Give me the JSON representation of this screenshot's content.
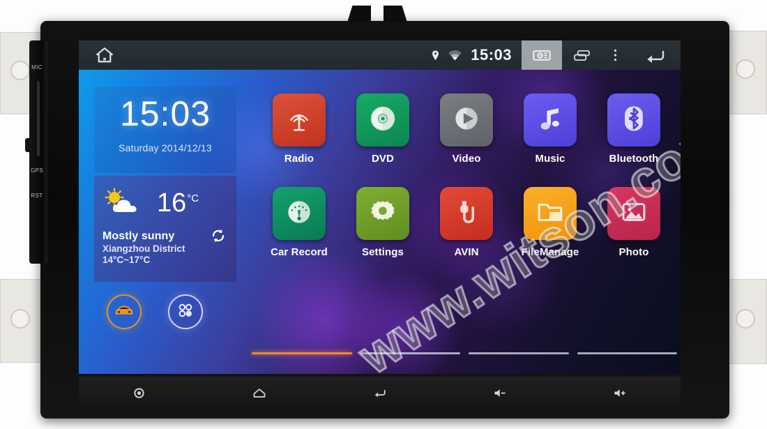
{
  "device": {
    "side_labels": [
      "MIC",
      "GPS",
      "RST"
    ]
  },
  "statusbar": {
    "home_icon": "home-icon",
    "location_icon": "location-pin-icon",
    "wifi_icon": "wifi-icon",
    "time": "15:03",
    "camera_icon": "camera-icon",
    "recents_icon": "recents-icon",
    "overflow_icon": "overflow-menu-icon",
    "back_icon": "back-arrow-icon"
  },
  "clock_widget": {
    "time": "15:03",
    "date": "Saturday 2014/12/13"
  },
  "weather_widget": {
    "icon": "sun-behind-cloud-icon",
    "temperature": "16",
    "unit": "°C",
    "condition": "Mostly sunny",
    "location_range": "Xiangzhou District 14°C~17°C",
    "refresh_icon": "refresh-icon"
  },
  "quick_buttons": [
    {
      "name": "car-mode-button",
      "icon": "car-icon",
      "color": "#e0942f"
    },
    {
      "name": "all-apps-button",
      "icon": "apps-grid-icon",
      "color": "#d6d2e8"
    }
  ],
  "apps": [
    {
      "label": "Radio",
      "icon": "radio-antenna-icon",
      "color": "#d0402c"
    },
    {
      "label": "DVD",
      "icon": "disc-icon",
      "color": "#129a5c"
    },
    {
      "label": "Video",
      "icon": "play-circle-icon",
      "color": "#6f7277"
    },
    {
      "label": "Music",
      "icon": "music-note-icon",
      "color": "#5a4de0"
    },
    {
      "label": "Bluetooth",
      "icon": "bluetooth-icon",
      "color": "#5a4de0"
    },
    {
      "label": "Car Record",
      "icon": "gauge-icon",
      "color": "#0f8f62"
    },
    {
      "label": "Settings",
      "icon": "gear-icon",
      "color": "#6e9b2a"
    },
    {
      "label": "AVIN",
      "icon": "av-plug-icon",
      "color": "#d6392c"
    },
    {
      "label": "FileManage",
      "icon": "folder-icon",
      "color": "#f2a01c"
    },
    {
      "label": "Photo",
      "icon": "image-icon",
      "color": "#c62a52"
    }
  ],
  "page_indicator": {
    "count": 4,
    "active_index": 0,
    "active_color": "#f08a2e"
  },
  "hardware_buttons": [
    {
      "name": "power-button",
      "icon": "power-circle-icon"
    },
    {
      "name": "home-button",
      "icon": "home-outline-icon"
    },
    {
      "name": "back-button",
      "icon": "back-arrow-icon"
    },
    {
      "name": "volume-down-button",
      "icon": "volume-down-icon"
    },
    {
      "name": "volume-up-button",
      "icon": "volume-up-icon"
    }
  ],
  "watermark": {
    "text": "www.witson.com"
  }
}
